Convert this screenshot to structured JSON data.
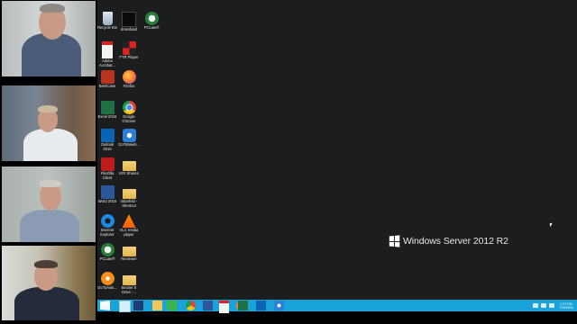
{
  "video_tiles": [
    {
      "id": "participant-1"
    },
    {
      "id": "participant-2"
    },
    {
      "id": "participant-3"
    },
    {
      "id": "participant-4"
    }
  ],
  "desktop": {
    "icons": [
      {
        "label": "Recycle Bin",
        "icon": "recycle-bin-icon"
      },
      {
        "label": "download",
        "icon": "download-icon"
      },
      {
        "label": "PCLaw®",
        "icon": "pclaw-icon"
      },
      {
        "label": "Adobe\nAcrobat...",
        "icon": "acrobat-icon"
      },
      {
        "label": "FTR Player",
        "icon": "ftr-player-icon"
      },
      {
        "label": "BestCase",
        "icon": "bestcase-icon"
      },
      {
        "label": "Firefox",
        "icon": "firefox-icon"
      },
      {
        "label": "Excel 2016",
        "icon": "excel-icon"
      },
      {
        "label": "Google\nChrome",
        "icon": "chrome-icon"
      },
      {
        "label": "Outlook 2016",
        "icon": "outlook-icon"
      },
      {
        "label": "GoToMeeti...",
        "icon": "gotomeeting-icon"
      },
      {
        "label": "FileZilla\nClient",
        "icon": "filezilla-icon"
      },
      {
        "label": "KRI Shares",
        "icon": "folder-icon"
      },
      {
        "label": "Word 2016",
        "icon": "word-icon"
      },
      {
        "label": "mbarfeld -\nShortcut",
        "icon": "shortcut-icon"
      },
      {
        "label": "Internet\nExplorer",
        "icon": "ie-icon"
      },
      {
        "label": "VLC media\nplayer",
        "icon": "vlc-icon"
      },
      {
        "label": "PCLaw®",
        "icon": "pclaw-icon"
      },
      {
        "label": "Reviewer",
        "icon": "folder-icon"
      },
      {
        "label": "GoToAssi...",
        "icon": "gotoassist-icon"
      },
      {
        "label": "Becker 5\nDrive -...",
        "icon": "folder-icon"
      }
    ],
    "branding": "Windows Server 2012 R2"
  },
  "taskbar": {
    "buttons": [
      {
        "icon": "start-icon"
      },
      {
        "icon": "server-manager-icon"
      },
      {
        "icon": "powershell-icon"
      },
      {
        "icon": "file-explorer-icon"
      },
      {
        "icon": "green-app-icon"
      },
      {
        "icon": "chrome-icon"
      },
      {
        "icon": "word-icon"
      },
      {
        "icon": "acrobat-icon"
      },
      {
        "icon": "firefox-icon"
      },
      {
        "icon": "excel-icon"
      },
      {
        "icon": "outlook-icon"
      },
      {
        "icon": "gotomeeting-icon"
      }
    ],
    "clock": {
      "time": "1:27 PM",
      "date": "7/16/2020"
    }
  },
  "colors": {
    "taskbar": "#1aa3d8",
    "desktop": "#1b1d1f"
  }
}
